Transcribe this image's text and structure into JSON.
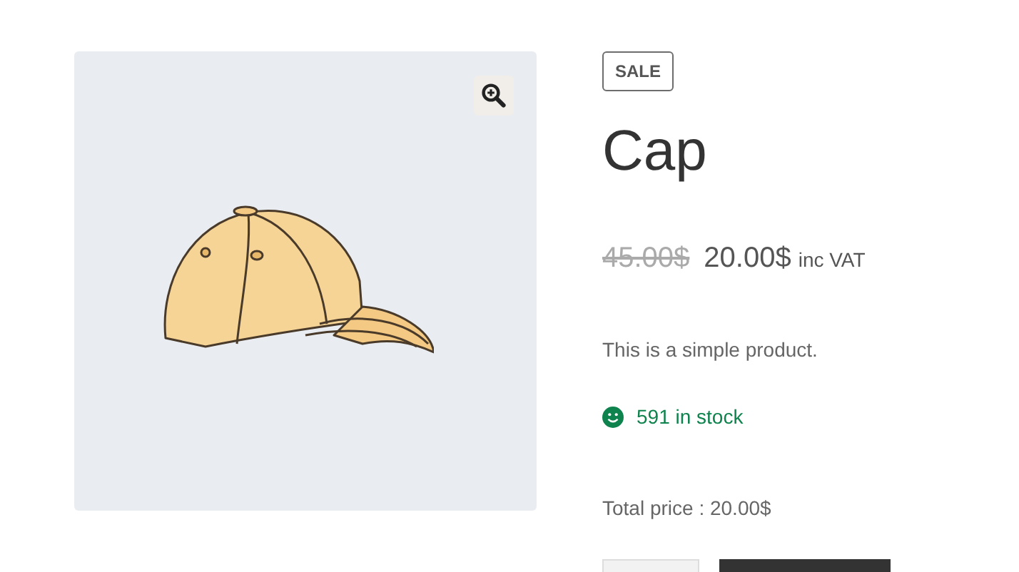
{
  "product": {
    "badge": "SALE",
    "title": "Cap",
    "regular_price": "45.00$",
    "sale_price": "20.00$",
    "price_suffix": "inc VAT",
    "description": "This is a simple product.",
    "stock": "591 in stock",
    "total_price": "Total price : 20.00$"
  }
}
